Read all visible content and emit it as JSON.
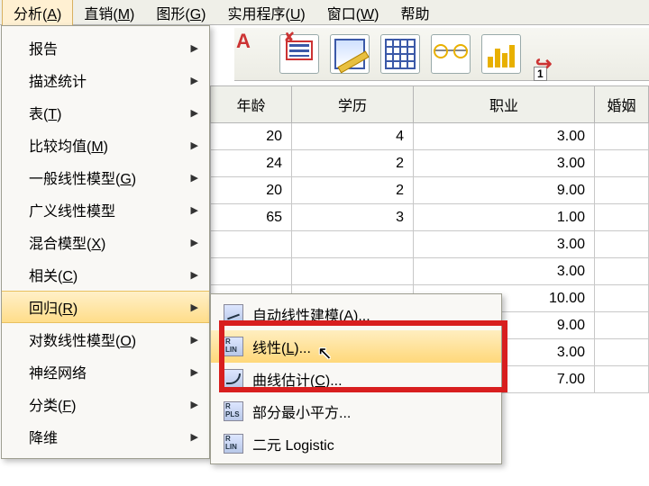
{
  "menubar": [
    {
      "label": "分析(",
      "mn": "A",
      "tail": ")",
      "active": true
    },
    {
      "label": "直销(",
      "mn": "M",
      "tail": ")"
    },
    {
      "label": "图形(",
      "mn": "G",
      "tail": ")"
    },
    {
      "label": "实用程序(",
      "mn": "U",
      "tail": ")"
    },
    {
      "label": "窗口(",
      "mn": "W",
      "tail": ")"
    },
    {
      "label": "帮助",
      "mn": "",
      "tail": ""
    }
  ],
  "dropdown": [
    {
      "label": "报告",
      "arrow": true
    },
    {
      "label": "描述统计",
      "arrow": true
    },
    {
      "label": "表(",
      "mn": "T",
      "tail": ")",
      "arrow": true
    },
    {
      "label": "比较均值(",
      "mn": "M",
      "tail": ")",
      "arrow": true
    },
    {
      "label": "一般线性模型(",
      "mn": "G",
      "tail": ")",
      "arrow": true
    },
    {
      "label": "广义线性模型",
      "arrow": true
    },
    {
      "label": "混合模型(",
      "mn": "X",
      "tail": ")",
      "arrow": true
    },
    {
      "label": "相关(",
      "mn": "C",
      "tail": ")",
      "arrow": true
    },
    {
      "label": "回归(",
      "mn": "R",
      "tail": ")",
      "arrow": true,
      "hover": true
    },
    {
      "label": "对数线性模型(",
      "mn": "O",
      "tail": ")",
      "arrow": true
    },
    {
      "label": "神经网络",
      "arrow": true
    },
    {
      "label": "分类(",
      "mn": "F",
      "tail": ")",
      "arrow": true
    },
    {
      "label": "降维",
      "arrow": true
    }
  ],
  "submenu": [
    {
      "icon": "a",
      "label": "自动线性建模(",
      "mn": "A",
      "tail": ")..."
    },
    {
      "icon": "l",
      "label": "线性(",
      "mn": "L",
      "tail": ")...",
      "hover": true
    },
    {
      "icon": "c",
      "label": "曲线估计(",
      "mn": "C",
      "tail": ")..."
    },
    {
      "icon": "p",
      "label": "部分最小平方..."
    },
    {
      "icon": "l",
      "label": "二元 Logistic"
    }
  ],
  "sheet": {
    "headers": [
      "年龄",
      "学历",
      "职业",
      "婚姻"
    ],
    "rows": [
      [
        "20",
        "4",
        "3.00",
        ""
      ],
      [
        "24",
        "2",
        "3.00",
        ""
      ],
      [
        "20",
        "2",
        "9.00",
        ""
      ],
      [
        "65",
        "3",
        "1.00",
        ""
      ],
      [
        "",
        "",
        "3.00",
        ""
      ],
      [
        "",
        "",
        "3.00",
        ""
      ],
      [
        "",
        "",
        "10.00",
        ""
      ],
      [
        "",
        "",
        "9.00",
        ""
      ],
      [
        "",
        "",
        "3.00",
        ""
      ],
      [
        "",
        "",
        "7.00",
        ""
      ]
    ]
  }
}
